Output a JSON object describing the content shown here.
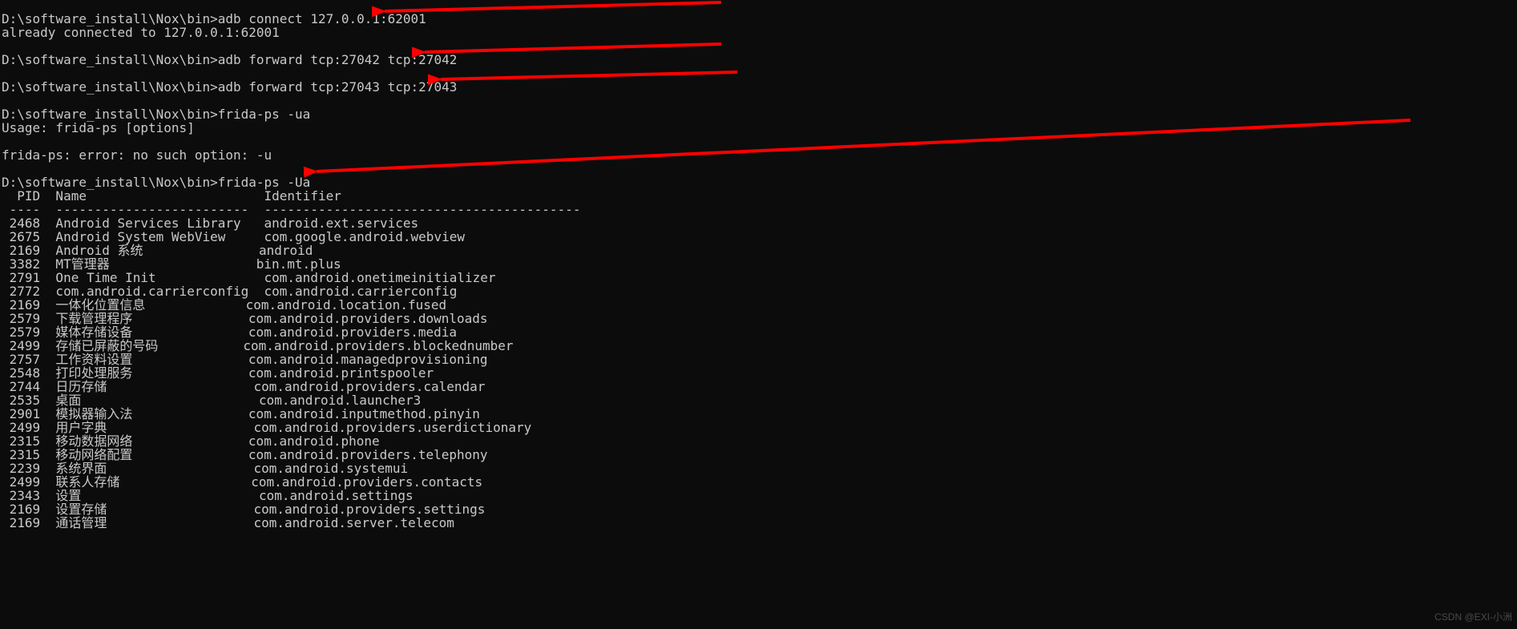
{
  "prompt": "D:\\software_install\\Nox\\bin>",
  "cmds": {
    "c1": "adb connect 127.0.0.1:62001",
    "c1_out": "already connected to 127.0.0.1:62001",
    "c2": "adb forward tcp:27042 tcp:27042",
    "c3": "adb forward tcp:27043 tcp:27043",
    "c4": "frida-ps -ua",
    "c4_out1": "Usage: frida-ps [options]",
    "c4_out2": "frida-ps: error: no such option: -u",
    "c5": "frida-ps -Ua"
  },
  "table": {
    "header_line": "  PID  Name                       Identifier",
    "divider_line": " ----  -------------------------  -----------------------------------------",
    "rows": [
      {
        "pid": "2468",
        "name": "Android Services Library",
        "identifier": "android.ext.services"
      },
      {
        "pid": "2675",
        "name": "Android System WebView",
        "identifier": "com.google.android.webview"
      },
      {
        "pid": "2169",
        "name": "Android 系统",
        "identifier": "android"
      },
      {
        "pid": "3382",
        "name": "MT管理器",
        "identifier": "bin.mt.plus"
      },
      {
        "pid": "2791",
        "name": "One Time Init",
        "identifier": "com.android.onetimeinitializer"
      },
      {
        "pid": "2772",
        "name": "com.android.carrierconfig",
        "identifier": "com.android.carrierconfig"
      },
      {
        "pid": "2169",
        "name": "一体化位置信息",
        "identifier": "com.android.location.fused"
      },
      {
        "pid": "2579",
        "name": "下载管理程序",
        "identifier": "com.android.providers.downloads"
      },
      {
        "pid": "2579",
        "name": "媒体存储设备",
        "identifier": "com.android.providers.media"
      },
      {
        "pid": "2499",
        "name": "存储已屏蔽的号码",
        "identifier": "com.android.providers.blockednumber"
      },
      {
        "pid": "2757",
        "name": "工作资料设置",
        "identifier": "com.android.managedprovisioning"
      },
      {
        "pid": "2548",
        "name": "打印处理服务",
        "identifier": "com.android.printspooler"
      },
      {
        "pid": "2744",
        "name": "日历存储",
        "identifier": "com.android.providers.calendar"
      },
      {
        "pid": "2535",
        "name": "桌面",
        "identifier": "com.android.launcher3"
      },
      {
        "pid": "2901",
        "name": "模拟器输入法",
        "identifier": "com.android.inputmethod.pinyin"
      },
      {
        "pid": "2499",
        "name": "用户字典",
        "identifier": "com.android.providers.userdictionary"
      },
      {
        "pid": "2315",
        "name": "移动数据网络",
        "identifier": "com.android.phone"
      },
      {
        "pid": "2315",
        "name": "移动网络配置",
        "identifier": "com.android.providers.telephony"
      },
      {
        "pid": "2239",
        "name": "系统界面",
        "identifier": "com.android.systemui"
      },
      {
        "pid": "2499",
        "name": "联系人存储",
        "identifier": "com.android.providers.contacts"
      },
      {
        "pid": "2343",
        "name": "设置",
        "identifier": "com.android.settings"
      },
      {
        "pid": "2169",
        "name": "设置存储",
        "identifier": "com.android.providers.settings"
      },
      {
        "pid": "2169",
        "name": "通话管理",
        "identifier": "com.android.server.telecom"
      }
    ]
  },
  "watermark": "CSDN @EXI-小洲"
}
